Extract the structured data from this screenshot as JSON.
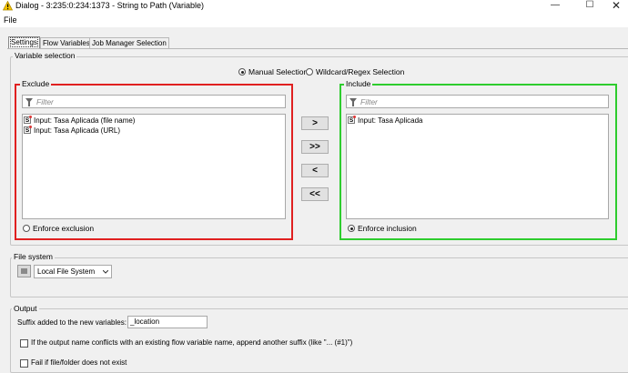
{
  "window": {
    "title": "Dialog - 3:235:0:234:1373 - String to Path (Variable)",
    "icon": "warning-triangle-icon",
    "controls": [
      "minimize",
      "maximize",
      "close"
    ]
  },
  "menu": {
    "items": [
      "File"
    ]
  },
  "tabs": [
    {
      "label": "Settings",
      "active": true
    },
    {
      "label": "Flow Variables",
      "active": false
    },
    {
      "label": "Job Manager Selection",
      "active": false
    }
  ],
  "variable_selection": {
    "legend": "Variable selection",
    "modes": [
      {
        "label": "Manual Selection",
        "selected": true
      },
      {
        "label": "Wildcard/Regex Selection",
        "selected": false
      }
    ],
    "exclude": {
      "title": "Exclude",
      "border_color": "#e02020",
      "filter_placeholder": "Filter",
      "items": [
        "Input: Tasa Aplicada (file name)",
        "Input: Tasa Aplicada (URL)"
      ],
      "enforce_label": "Enforce exclusion",
      "enforce_selected": false
    },
    "include": {
      "title": "Include",
      "border_color": "#2ecc2e",
      "filter_placeholder": "Filter",
      "items": [
        "Input: Tasa Aplicada"
      ],
      "enforce_label": "Enforce inclusion",
      "enforce_selected": true
    },
    "buttons": {
      "add": ">",
      "add_all": ">>",
      "remove": "<",
      "remove_all": "<<"
    }
  },
  "file_system": {
    "legend": "File system",
    "selected": "Local File System"
  },
  "output": {
    "legend": "Output",
    "suffix_label": "Suffix added to the new variables:",
    "suffix_value": "_location",
    "conflict_label": "If the output name conflicts with an existing flow variable name, append another suffix (like \"... (#1)\")",
    "conflict_checked": false,
    "fail_label": "Fail if file/folder does not exist",
    "fail_checked": false
  }
}
